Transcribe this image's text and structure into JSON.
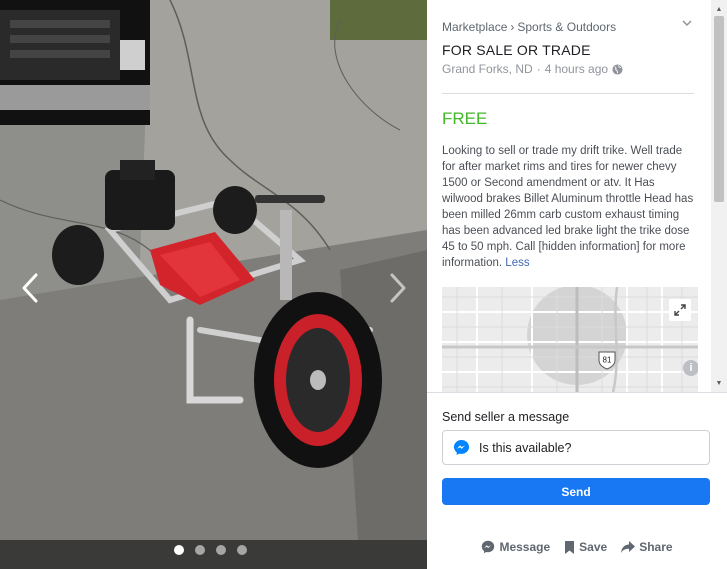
{
  "viewer": {
    "photo_count": 4,
    "active_photo": 1,
    "prev_icon": "chevron-left-icon",
    "next_icon": "chevron-right-icon"
  },
  "listing": {
    "breadcrumb": [
      "Marketplace",
      "Sports & Outdoors"
    ],
    "breadcrumb_separator": "›",
    "title": "FOR SALE OR TRADE",
    "location": "Grand Forks, ND",
    "meta_separator": "·",
    "posted": "4 hours ago",
    "privacy_icon": "globe-icon",
    "price": "FREE",
    "price_color": "#42b72a",
    "description": "Looking to sell or trade my drift trike. Well trade for after market rims and tires for newer chevy 1500 or Second amendment or atv. It Has wilwood brakes Billet Aluminum throttle Head has been milled 26mm carb custom exhaust timing has been advanced led brake light the trike dose 45 to 50 mph. Call [hidden information] for more information.",
    "more_link": "Less"
  },
  "map": {
    "route_label": "81",
    "expand_icon": "expand-icon",
    "info_label": "i"
  },
  "message": {
    "label": "Send seller a message",
    "input_value": "Is this available?",
    "send_label": "Send",
    "send_color": "#1877f2"
  },
  "actions": [
    {
      "label": "Message",
      "icon": "messenger-icon"
    },
    {
      "label": "Save",
      "icon": "bookmark-icon"
    },
    {
      "label": "Share",
      "icon": "share-arrow-icon"
    }
  ]
}
